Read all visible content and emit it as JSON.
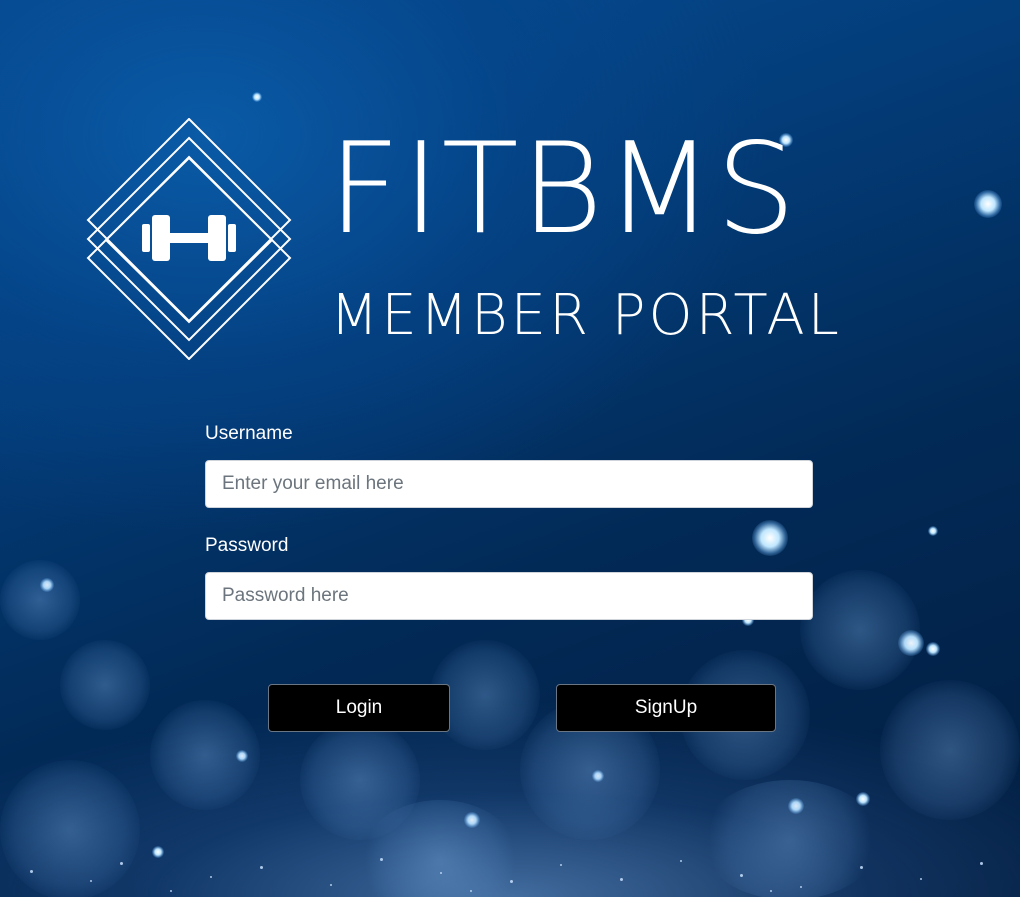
{
  "brand": {
    "title": "FITBMS",
    "subtitle": "MEMBER PORTAL",
    "logo_icon": "dumbbell-icon"
  },
  "login_form": {
    "username": {
      "label": "Username",
      "placeholder": "Enter your email here",
      "value": ""
    },
    "password": {
      "label": "Password",
      "placeholder": "Password here",
      "value": ""
    },
    "login_button": "Login",
    "signup_button": "SignUp"
  },
  "colors": {
    "background_top": "#064e97",
    "background_bottom": "#021d3f",
    "button_bg": "#000000",
    "text": "#ffffff"
  }
}
